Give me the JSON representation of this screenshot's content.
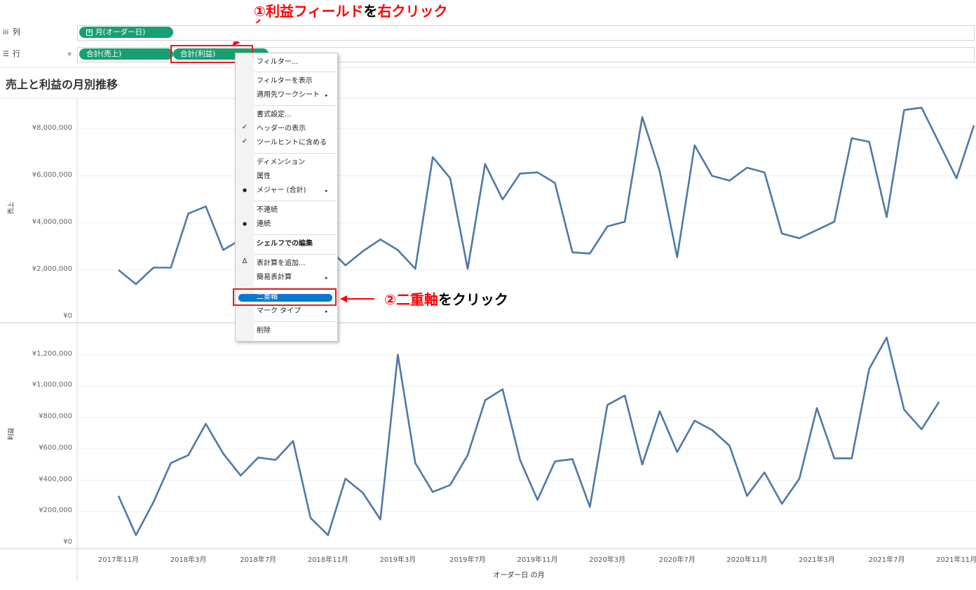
{
  "annotations": {
    "step1_num": "①",
    "step1_red": "利益フィールド",
    "step1_mid": "を",
    "step1_red2": "右クリック",
    "step2_num": "②",
    "step2_red": "二重軸",
    "step2_rest": "をクリック"
  },
  "shelves": {
    "columns_label": "列",
    "rows_label": "行",
    "columns_pill": "月(オーダー日)",
    "rows_pill_1": "合計(売上)",
    "rows_pill_2": "合計(利益)"
  },
  "chart_title": "売上と利益の月別推移",
  "context_menu": {
    "items": [
      "フィルター...",
      "フィルターを表示",
      "適用先ワークシート",
      "書式設定...",
      "ヘッダーの表示",
      "ツールヒントに含める",
      "ディメンション",
      "属性",
      "メジャー (合計)",
      "不連続",
      "連続",
      "シェルフでの編集",
      "表計算を追加...",
      "簡易表計算",
      "二重軸",
      "マーク タイプ",
      "削除"
    ],
    "check": "✓",
    "dot": "●",
    "delta": "Δ",
    "submenu_arrow": "▸"
  },
  "colors": {
    "accent": "#17a072",
    "line": "#4e79a7",
    "annotation": "#ff0000",
    "highlight": "#0b78d0"
  },
  "chart_data": {
    "type": "line",
    "xlabel": "オーダー日 の月",
    "x_ticks": [
      "2017年11月",
      "2018年3月",
      "2018年7月",
      "2018年11月",
      "2019年3月",
      "2019年7月",
      "2019年11月",
      "2020年3月",
      "2020年7月",
      "2020年11月",
      "2021年3月",
      "2021年7月",
      "2021年11月"
    ],
    "x": [
      "2017-11",
      "2017-12",
      "2018-01",
      "2018-02",
      "2018-03",
      "2018-04",
      "2018-05",
      "2018-06",
      "2018-07",
      "2018-08",
      "2018-09",
      "2018-10",
      "2018-11",
      "2018-12",
      "2019-01",
      "2019-02",
      "2019-03",
      "2019-04",
      "2019-05",
      "2019-06",
      "2019-07",
      "2019-08",
      "2019-09",
      "2019-10",
      "2019-11",
      "2019-12",
      "2020-01",
      "2020-02",
      "2020-03",
      "2020-04",
      "2020-05",
      "2020-06",
      "2020-07",
      "2020-08",
      "2020-09",
      "2020-10",
      "2020-11",
      "2020-12",
      "2021-01",
      "2021-02",
      "2021-03",
      "2021-04",
      "2021-05",
      "2021-06",
      "2021-07",
      "2021-08",
      "2021-09",
      "2021-10",
      "2021-11",
      "2021-12"
    ],
    "panes": [
      {
        "name": "売上",
        "ylabel": "売上",
        "ylim": [
          0,
          9300000
        ],
        "y_ticks": [
          "¥0",
          "¥2,000,000",
          "¥4,000,000",
          "¥6,000,000",
          "¥8,000,000"
        ],
        "y_tick_values": [
          0,
          2000000,
          4000000,
          6000000,
          8000000
        ],
        "values": [
          2000000,
          1400000,
          2100000,
          2100000,
          4400000,
          4700000,
          2850000,
          3300000,
          3250000,
          2900000,
          2750000,
          2600000,
          2950000,
          2200000,
          2800000,
          3300000,
          2850000,
          2050000,
          6800000,
          5900000,
          2050000,
          6500000,
          5000000,
          6100000,
          6150000,
          5700000,
          2750000,
          2700000,
          3850000,
          4050000,
          8500000,
          6200000,
          2550000,
          7300000,
          6000000,
          5800000,
          6350000,
          6150000,
          3550000,
          3350000,
          3700000,
          4050000,
          7600000,
          7450000,
          4250000,
          8800000,
          8900000,
          7400000,
          5900000,
          8150000
        ]
      },
      {
        "name": "利益",
        "ylabel": "利益",
        "ylim": [
          0,
          1400000
        ],
        "y_ticks": [
          "¥0",
          "¥200,000",
          "¥400,000",
          "¥600,000",
          "¥800,000",
          "¥1,000,000",
          "¥1,200,000"
        ],
        "y_tick_values": [
          0,
          200000,
          400000,
          600000,
          800000,
          1000000,
          1200000
        ],
        "values": [
          300000,
          50000,
          260000,
          510000,
          560000,
          760000,
          570000,
          430000,
          545000,
          530000,
          650000,
          160000,
          50000,
          410000,
          320000,
          150000,
          1200000,
          510000,
          325000,
          370000,
          560000,
          910000,
          980000,
          530000,
          275000,
          520000,
          535000,
          230000,
          880000,
          940000,
          500000,
          840000,
          580000,
          780000,
          720000,
          620000,
          300000,
          450000,
          250000,
          410000,
          860000,
          540000,
          540000,
          1110000,
          1310000,
          850000,
          725000,
          900000,
          null,
          null
        ]
      }
    ]
  }
}
